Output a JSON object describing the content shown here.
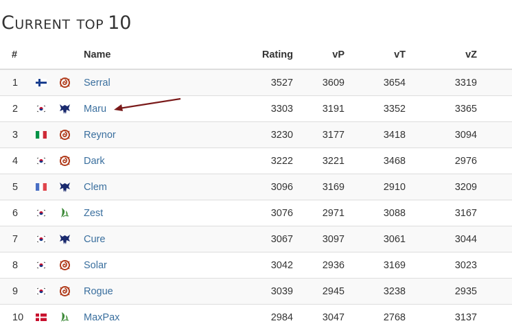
{
  "heading": {
    "caps": "Current top",
    "number": "10"
  },
  "columns": {
    "rank": "#",
    "name": "Name",
    "rating": "Rating",
    "vP": "vP",
    "vT": "vT",
    "vZ": "vZ"
  },
  "players": [
    {
      "rank": "1",
      "flag": "fi-flag-icon",
      "race": "zerg-icon",
      "name": "Serral",
      "rating": "3527",
      "vP": "3609",
      "vT": "3654",
      "vZ": "3319"
    },
    {
      "rank": "2",
      "flag": "kr-flag-icon",
      "race": "terran-icon",
      "name": "Maru",
      "rating": "3303",
      "vP": "3191",
      "vT": "3352",
      "vZ": "3365"
    },
    {
      "rank": "3",
      "flag": "it-flag-icon",
      "race": "zerg-icon",
      "name": "Reynor",
      "rating": "3230",
      "vP": "3177",
      "vT": "3418",
      "vZ": "3094"
    },
    {
      "rank": "4",
      "flag": "kr-flag-icon",
      "race": "zerg-icon",
      "name": "Dark",
      "rating": "3222",
      "vP": "3221",
      "vT": "3468",
      "vZ": "2976"
    },
    {
      "rank": "5",
      "flag": "fr-flag-icon",
      "race": "terran-icon",
      "name": "Clem",
      "rating": "3096",
      "vP": "3169",
      "vT": "2910",
      "vZ": "3209"
    },
    {
      "rank": "6",
      "flag": "kr-flag-icon",
      "race": "protoss-icon",
      "name": "Zest",
      "rating": "3076",
      "vP": "2971",
      "vT": "3088",
      "vZ": "3167"
    },
    {
      "rank": "7",
      "flag": "kr-flag-icon",
      "race": "terran-icon",
      "name": "Cure",
      "rating": "3067",
      "vP": "3097",
      "vT": "3061",
      "vZ": "3044"
    },
    {
      "rank": "8",
      "flag": "kr-flag-icon",
      "race": "zerg-icon",
      "name": "Solar",
      "rating": "3042",
      "vP": "2936",
      "vT": "3169",
      "vZ": "3023"
    },
    {
      "rank": "9",
      "flag": "kr-flag-icon",
      "race": "zerg-icon",
      "name": "Rogue",
      "rating": "3039",
      "vP": "2945",
      "vT": "3238",
      "vZ": "2935"
    },
    {
      "rank": "10",
      "flag": "dk-flag-icon",
      "race": "protoss-icon",
      "name": "MaxPax",
      "rating": "2984",
      "vP": "3047",
      "vT": "2768",
      "vZ": "3137"
    }
  ],
  "colors": {
    "link": "#3a6f9e",
    "stripe": "#f9f9f9",
    "border": "#dddddd",
    "annotation_arrow": "#7a1a1a",
    "terran": "#1a2a6e",
    "zerg": "#b03a1a",
    "protoss": "#3e8a3a"
  },
  "annotation": {
    "icon": "arrow-annotation-icon",
    "points_to": "Maru"
  }
}
